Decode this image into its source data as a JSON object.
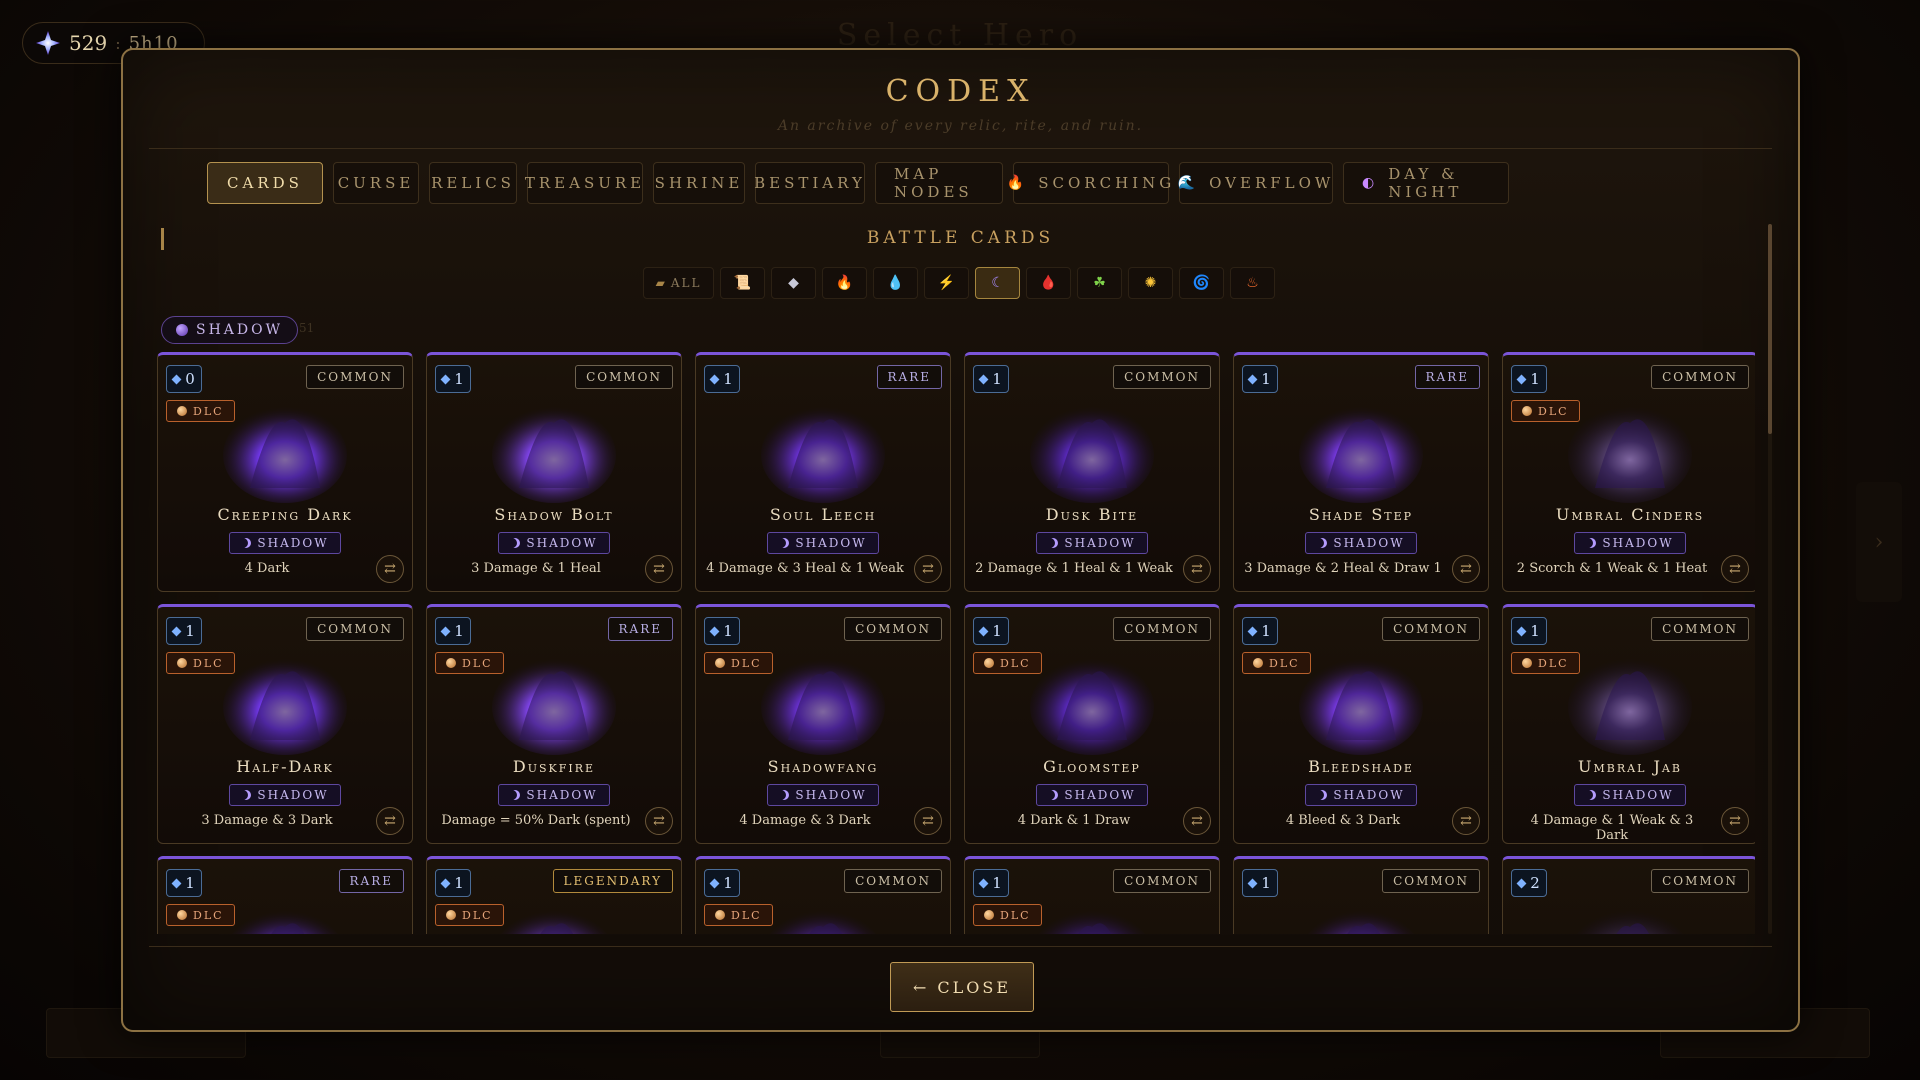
{
  "background": {
    "title": "Select Hero"
  },
  "currency": {
    "amount": "529",
    "separator": ":",
    "time": "5h10"
  },
  "codex": {
    "title": "CODEX",
    "subtitle": "An archive of every relic, rite, and ruin.",
    "tabs": [
      {
        "label": "CARDS",
        "icon": ""
      },
      {
        "label": "CURSE",
        "icon": ""
      },
      {
        "label": "RELICS",
        "icon": ""
      },
      {
        "label": "TREASURE",
        "icon": ""
      },
      {
        "label": "SHRINE",
        "icon": ""
      },
      {
        "label": "BESTIARY",
        "icon": ""
      },
      {
        "label": "MAP NODES",
        "icon": ""
      },
      {
        "label": "SCORCHING",
        "icon": "flame-icon"
      },
      {
        "label": "OVERFLOW",
        "icon": "wave-icon"
      },
      {
        "label": "DAY & NIGHT",
        "icon": "sun-moon-icon"
      }
    ],
    "active_tab": "CARDS",
    "section_title": "BATTLE CARDS",
    "filters": [
      {
        "label": "ALL",
        "icon": "cards-icon"
      },
      {
        "label": "",
        "icon": "scroll-icon"
      },
      {
        "label": "",
        "icon": "crystal-icon"
      },
      {
        "label": "",
        "icon": "fire-icon"
      },
      {
        "label": "",
        "icon": "water-icon"
      },
      {
        "label": "",
        "icon": "lightning-icon"
      },
      {
        "label": "",
        "icon": "moon-icon"
      },
      {
        "label": "",
        "icon": "blood-icon"
      },
      {
        "label": "",
        "icon": "poison-icon"
      },
      {
        "label": "",
        "icon": "sun-icon"
      },
      {
        "label": "",
        "icon": "swirl-icon"
      },
      {
        "label": "",
        "icon": "scorch-icon"
      }
    ],
    "active_filter": "moon-icon",
    "element_chip": {
      "label": "SHADOW",
      "count": "51"
    },
    "element_label": "SHADOW",
    "cards": [
      {
        "cost": "0",
        "rarity": "COMMON",
        "dlc": true,
        "name": "Creeping Dark",
        "desc": "4 Dark"
      },
      {
        "cost": "1",
        "rarity": "COMMON",
        "dlc": false,
        "name": "Shadow Bolt",
        "desc": "3 Damage & 1 Heal"
      },
      {
        "cost": "1",
        "rarity": "RARE",
        "dlc": false,
        "name": "Soul Leech",
        "desc": "4 Damage & 3 Heal & 1 Weak"
      },
      {
        "cost": "1",
        "rarity": "COMMON",
        "dlc": false,
        "name": "Dusk Bite",
        "desc": "2 Damage & 1 Heal & 1 Weak"
      },
      {
        "cost": "1",
        "rarity": "RARE",
        "dlc": false,
        "name": "Shade Step",
        "desc": "3 Damage & 2 Heal & Draw 1"
      },
      {
        "cost": "1",
        "rarity": "COMMON",
        "dlc": true,
        "name": "Umbral Cinders",
        "desc": "2 Scorch & 1 Weak & 1 Heat"
      },
      {
        "cost": "1",
        "rarity": "COMMON",
        "dlc": true,
        "name": "Half-Dark",
        "desc": "3 Damage & 3 Dark"
      },
      {
        "cost": "1",
        "rarity": "RARE",
        "dlc": true,
        "name": "Duskfire",
        "desc": "Damage = 50% Dark (spent)"
      },
      {
        "cost": "1",
        "rarity": "COMMON",
        "dlc": true,
        "name": "Shadowfang",
        "desc": "4 Damage & 3 Dark"
      },
      {
        "cost": "1",
        "rarity": "COMMON",
        "dlc": true,
        "name": "Gloomstep",
        "desc": "4 Dark & 1 Draw"
      },
      {
        "cost": "1",
        "rarity": "COMMON",
        "dlc": true,
        "name": "Bleedshade",
        "desc": "4 Bleed & 3 Dark"
      },
      {
        "cost": "1",
        "rarity": "COMMON",
        "dlc": true,
        "name": "Umbral Jab",
        "desc": "4 Damage & 1 Weak & 3 Dark"
      },
      {
        "cost": "1",
        "rarity": "RARE",
        "dlc": true,
        "name": "",
        "desc": ""
      },
      {
        "cost": "1",
        "rarity": "LEGENDARY",
        "dlc": true,
        "name": "",
        "desc": ""
      },
      {
        "cost": "1",
        "rarity": "COMMON",
        "dlc": true,
        "name": "",
        "desc": ""
      },
      {
        "cost": "1",
        "rarity": "COMMON",
        "dlc": true,
        "name": "",
        "desc": ""
      },
      {
        "cost": "1",
        "rarity": "COMMON",
        "dlc": false,
        "name": "",
        "desc": ""
      },
      {
        "cost": "2",
        "rarity": "COMMON",
        "dlc": false,
        "name": "",
        "desc": ""
      }
    ],
    "dlc_label": "DLC",
    "close_label": "← CLOSE"
  },
  "colors": {
    "accent": "#d9b26a",
    "shadow": "#7b55d9",
    "dlc": "#b9612c",
    "cost": "#4b6c96"
  }
}
